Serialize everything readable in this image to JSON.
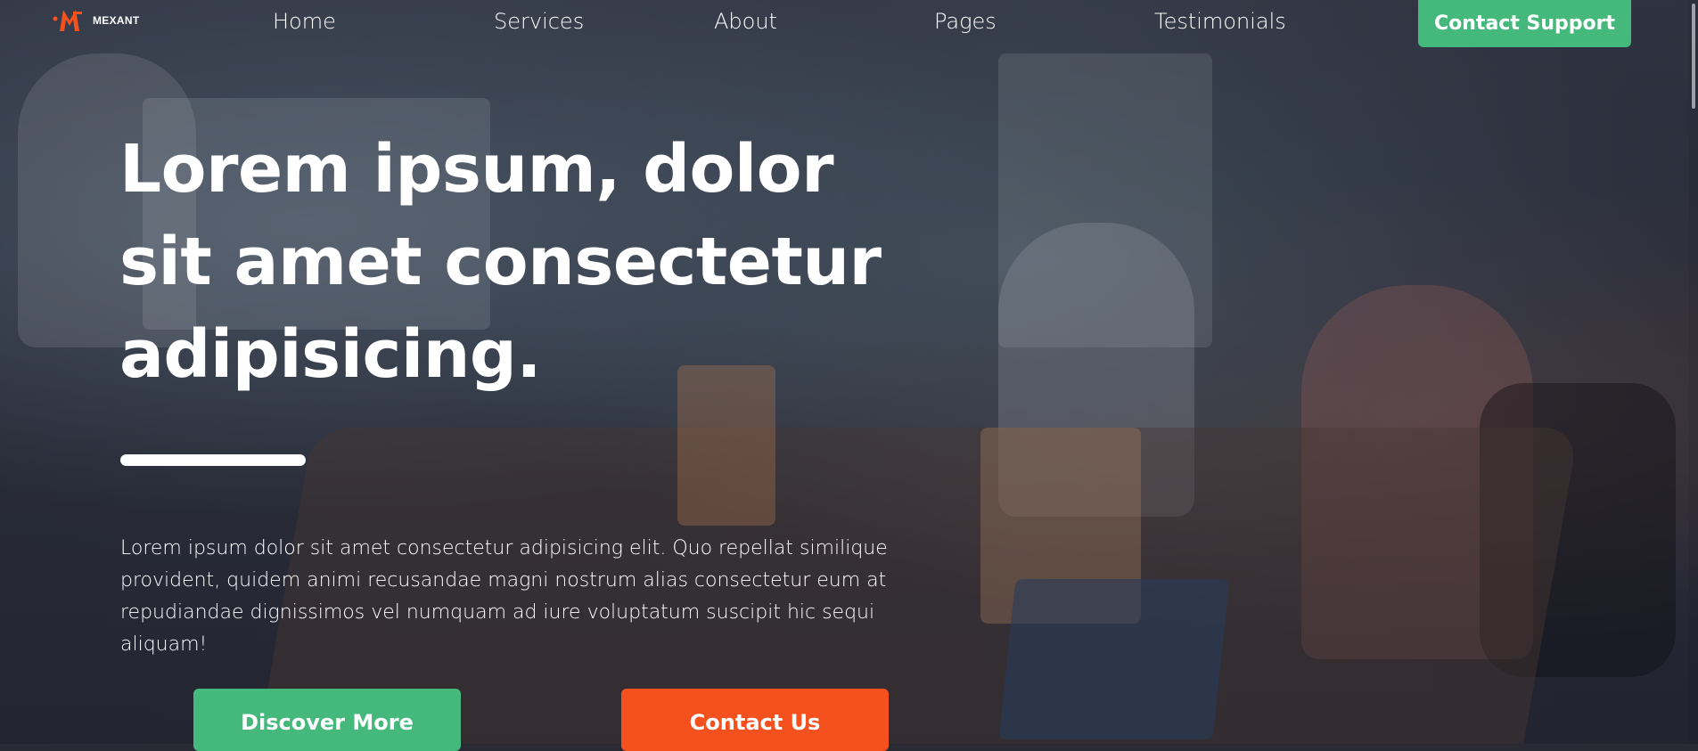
{
  "brand": {
    "name": "MEXANT",
    "accent": "#f4511e"
  },
  "nav": {
    "links": [
      "Home",
      "Services",
      "About",
      "Pages",
      "Testimonials"
    ],
    "support_button": "Contact Support"
  },
  "hero": {
    "title": "Lorem ipsum, dolor sit amet consectetur adipisicing.",
    "description": "Lorem ipsum dolor sit amet consectetur adipisicing elit. Quo repellat similique provident, quidem animi recusandae magni nostrum alias consectetur eum at repudiandae dignissimos vel numquam ad iure voluptatum suscipit hic sequi aliquam!",
    "buttons": {
      "discover": "Discover More",
      "contact": "Contact Us"
    }
  },
  "colors": {
    "green": "#45b97c",
    "orange": "#f4511e",
    "text": "#ffffff"
  }
}
